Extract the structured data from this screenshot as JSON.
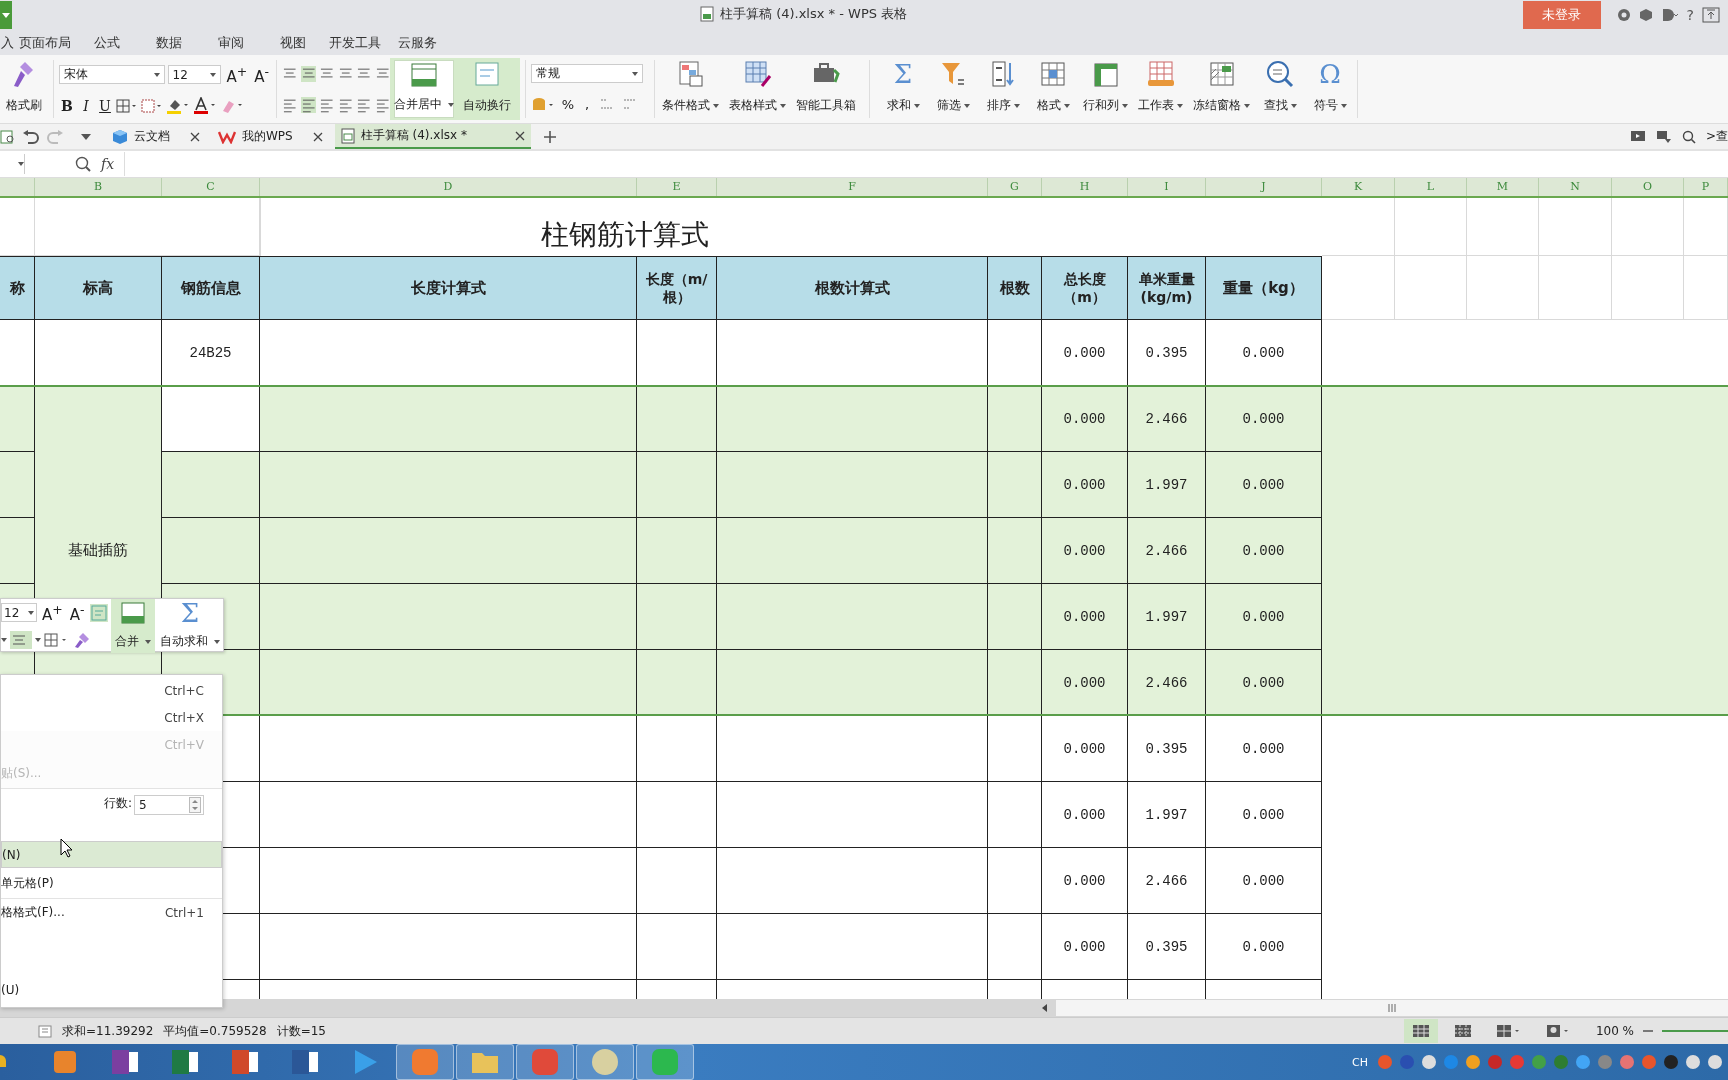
{
  "window": {
    "title": "柱手算稿 (4).xlsx * - WPS 表格",
    "login_button": "未登录",
    "help": "?"
  },
  "menu_tabs": [
    "入",
    "页面布局",
    "公式",
    "数据",
    "审阅",
    "视图",
    "开发工具",
    "云服务"
  ],
  "ribbon": {
    "format_painter": "格式刷",
    "font_name": "宋体",
    "font_size": "12",
    "font_buttons": [
      "A$^{+}$",
      "A$^{-}$"
    ],
    "style_buttons": [
      "B",
      "I",
      "U"
    ],
    "merge_center": "合并居中",
    "wrap_text": "自动换行",
    "number_format": "常规",
    "number_buttons": [
      "%",
      ","
    ],
    "tools": [
      {
        "label": "条件格式",
        "dropdown": true
      },
      {
        "label": "表格样式",
        "dropdown": true
      },
      {
        "label": "智能工具箱",
        "dropdown": false
      },
      {
        "label": "求和",
        "glyph": "Σ",
        "dropdown": true
      },
      {
        "label": "筛选",
        "dropdown": true
      },
      {
        "label": "排序",
        "dropdown": true
      },
      {
        "label": "格式",
        "dropdown": true
      },
      {
        "label": "行和列",
        "dropdown": true
      },
      {
        "label": "工作表",
        "dropdown": true
      },
      {
        "label": "冻结窗格",
        "dropdown": true
      },
      {
        "label": "查找",
        "dropdown": true
      },
      {
        "label": "符号",
        "glyph": "Ω",
        "dropdown": true
      }
    ]
  },
  "doc_tabs": [
    {
      "label": "云文档",
      "selected": false
    },
    {
      "label": "我的WPS",
      "selected": false
    },
    {
      "label": "柱手算稿 (4).xlsx *",
      "selected": true
    }
  ],
  "doc_search": ">查",
  "formula_bar": {
    "fx": "fx"
  },
  "columns": [
    "B",
    "C",
    "D",
    "E",
    "F",
    "G",
    "H",
    "I",
    "J",
    "K",
    "L",
    "M",
    "N",
    "O",
    "P"
  ],
  "sheet": {
    "title": "柱钢筋计算式",
    "headers": [
      "称",
      "标高",
      "钢筋信息",
      "长度计算式",
      "长度（m/根）",
      "根数计算式",
      "根数",
      "总长度（m）",
      "单米重量(kg/m)",
      "重量（kg）"
    ],
    "groups": [
      {
        "highlighted": false,
        "rows": [
          {
            "rebar": "24B25",
            "total_length": "0.000",
            "unit_weight": "0.395",
            "weight": "0.000"
          }
        ]
      },
      {
        "highlighted": true,
        "elevation": "基础插筋",
        "rows": [
          {
            "selected": true,
            "total_length": "0.000",
            "unit_weight": "2.466",
            "weight": "0.000"
          },
          {
            "selected": false,
            "total_length": "0.000",
            "unit_weight": "1.997",
            "weight": "0.000"
          },
          {
            "selected": false,
            "total_length": "0.000",
            "unit_weight": "2.466",
            "weight": "0.000"
          },
          {
            "selected": false,
            "total_length": "0.000",
            "unit_weight": "1.997",
            "weight": "0.000"
          },
          {
            "selected": false,
            "total_length": "0.000",
            "unit_weight": "2.466",
            "weight": "0.000"
          }
        ]
      },
      {
        "highlighted": false,
        "rows": [
          {
            "total_length": "0.000",
            "unit_weight": "0.395",
            "weight": "0.000"
          },
          {
            "total_length": "0.000",
            "unit_weight": "1.997",
            "weight": "0.000"
          },
          {
            "total_length": "0.000",
            "unit_weight": "2.466",
            "weight": "0.000"
          },
          {
            "total_length": "0.000",
            "unit_weight": "0.395",
            "weight": "0.000"
          }
        ]
      }
    ]
  },
  "mini_toolbar": {
    "font_size": "12",
    "font_buttons": [
      "A$^{+}$",
      "A$^{-}$"
    ],
    "merge": "合并",
    "autosum": "自动求和",
    "autosum_glyph": "Σ"
  },
  "context_menu": {
    "items": [
      {
        "kind": "command",
        "shortcut": "Ctrl+C",
        "disabled": false,
        "selected": false,
        "separator_after": false
      },
      {
        "kind": "command",
        "shortcut": "Ctrl+X",
        "disabled": false,
        "selected": false,
        "separator_after": false
      },
      {
        "kind": "command",
        "shortcut": "Ctrl+V",
        "disabled": true,
        "selected": false,
        "separator_after": false
      },
      {
        "kind": "command",
        "label": "贴(S)...",
        "disabled": true,
        "selected": false,
        "separator_after": true
      },
      {
        "kind": "count",
        "label": "行数:",
        "value": "5"
      },
      {
        "kind": "command",
        "label": "(N)",
        "disabled": false,
        "selected": true,
        "separator_after": false
      },
      {
        "kind": "command",
        "label": "单元格(P)",
        "disabled": false,
        "selected": false,
        "separator_after": true
      },
      {
        "kind": "command",
        "label": "格格式(F)...",
        "shortcut": "Ctrl+1",
        "disabled": false,
        "selected": false,
        "separator_after": false
      },
      {
        "kind": "bottom",
        "label": "(U)",
        "disabled": false,
        "selected": false,
        "separator_after": false
      }
    ]
  },
  "status_bar": {
    "items": [
      "求和=11.39292",
      "平均值=0.759528",
      "计数=15"
    ],
    "view_buttons": [
      {
        "selected": true
      },
      {
        "selected": false
      },
      {
        "selected": false
      },
      {
        "selected": false
      }
    ],
    "zoom": "100 %",
    "zoom_slider": {
      "level": 1
    }
  },
  "taskbar": {
    "apps": [
      {
        "open": false
      },
      {
        "open": false
      },
      {
        "open": false
      },
      {
        "open": false
      },
      {
        "open": false
      },
      {
        "open": false
      },
      {
        "open": true
      },
      {
        "open": true
      },
      {
        "open": true
      },
      {
        "open": true
      },
      {
        "open": true
      }
    ],
    "tray_label": "CH"
  }
}
